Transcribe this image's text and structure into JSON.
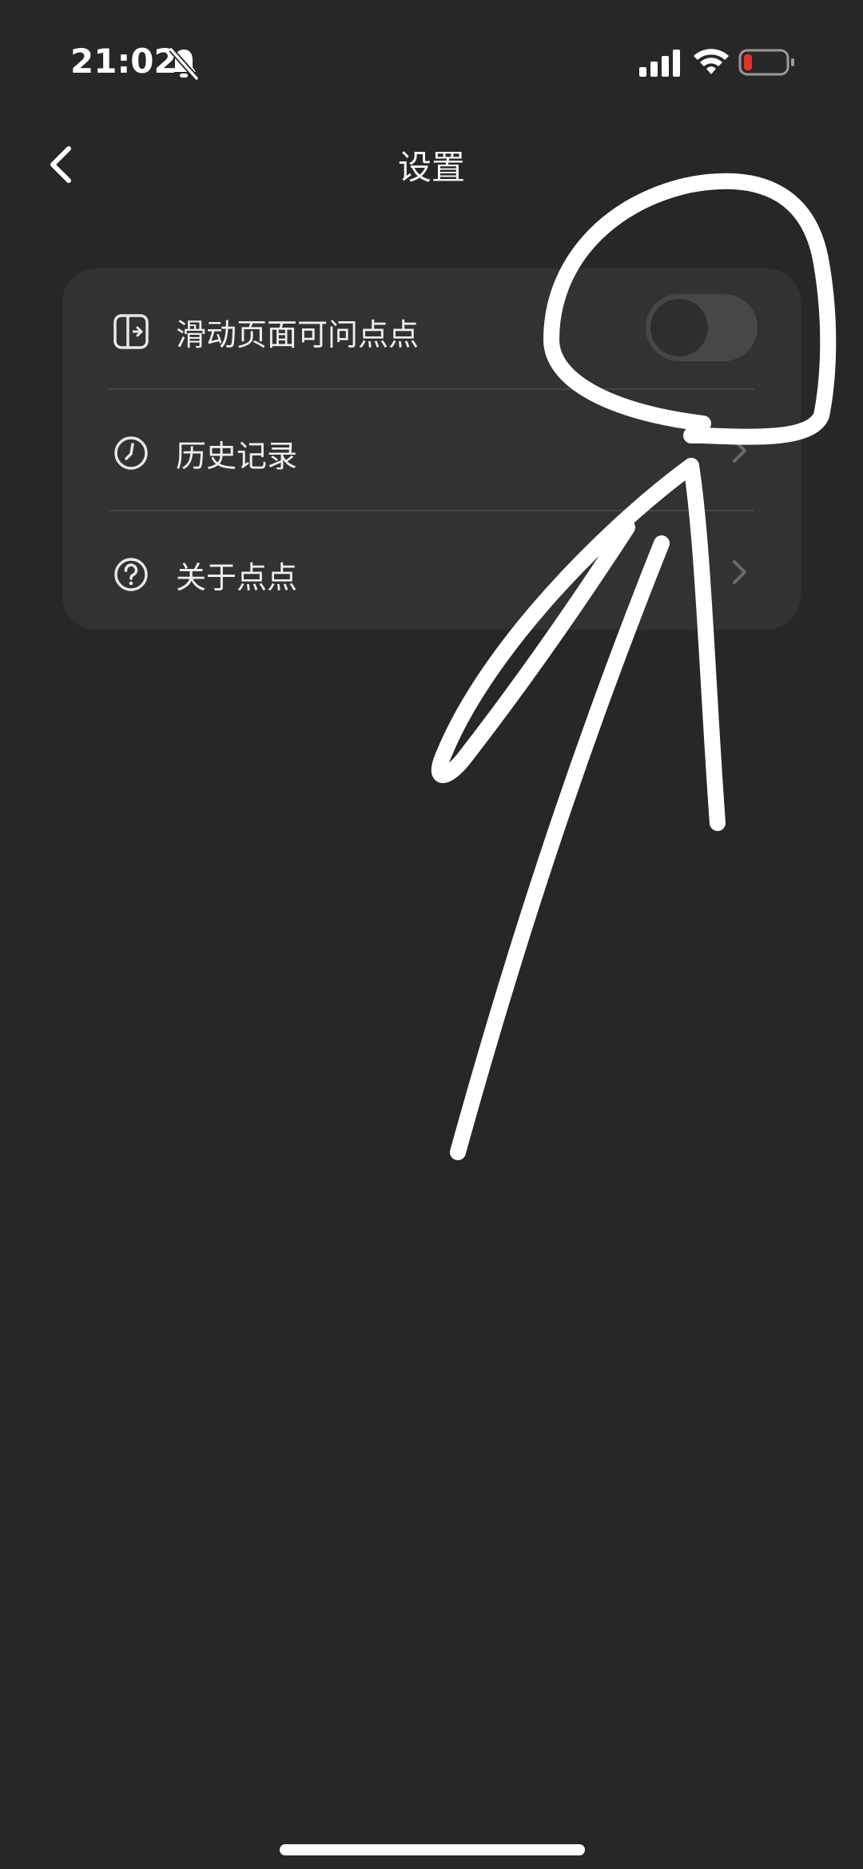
{
  "status_bar": {
    "time": "21:02",
    "icons": [
      "bell-slash-icon",
      "cellular-signal-icon",
      "wifi-icon",
      "battery-low-icon"
    ],
    "battery_color": "#e5332a"
  },
  "nav": {
    "back_icon": "chevron-left-icon",
    "title": "设置"
  },
  "settings": {
    "items": [
      {
        "icon": "swipe-panel-icon",
        "label": "滑动页面可问点点",
        "control": "toggle",
        "toggle_on": false
      },
      {
        "icon": "clock-icon",
        "label": "历史记录",
        "control": "chevron"
      },
      {
        "icon": "question-circle-icon",
        "label": "关于点点",
        "control": "chevron"
      }
    ]
  },
  "colors": {
    "background": "#272727",
    "card": "#323232",
    "annotation": "#ffffff"
  }
}
